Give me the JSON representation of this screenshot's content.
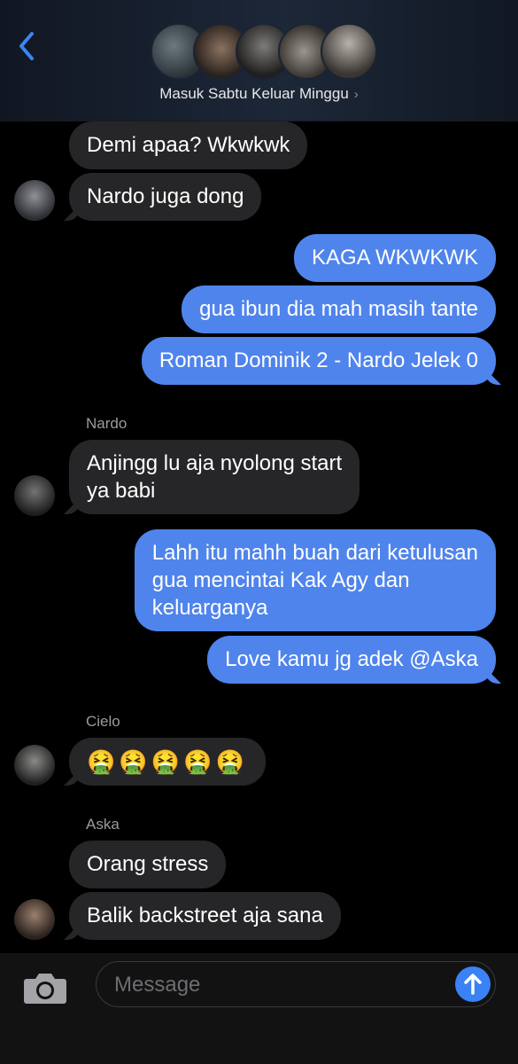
{
  "header": {
    "group_name": "Masuk Sabtu Keluar Minggu",
    "chevron": "›",
    "participants_count": 5
  },
  "messages": [
    {
      "side": "in",
      "text": "Demi apaa? Wkwkwk"
    },
    {
      "side": "in",
      "text": "Nardo juga dong"
    },
    {
      "side": "out",
      "text": "KAGA WKWKWK"
    },
    {
      "side": "out",
      "text": "gua ibun dia mah masih tante"
    },
    {
      "side": "out",
      "text": "Roman Dominik 2 - Nardo Jelek 0"
    },
    {
      "side": "in",
      "sender": "Nardo",
      "lines": [
        "Anjingg lu aja nyolong start",
        "ya babi"
      ]
    },
    {
      "side": "out",
      "lines": [
        "Lahh itu mahh buah dari ketulusan",
        "gua mencintai Kak Agy dan",
        "keluarganya"
      ]
    },
    {
      "side": "out",
      "text": "Love kamu jg adek @Aska"
    },
    {
      "side": "in",
      "sender": "Cielo",
      "text": "🤮🤮🤮🤮🤮"
    },
    {
      "side": "in",
      "sender": "Aska",
      "text": "Orang stress"
    },
    {
      "side": "in",
      "text": "Balik backstreet aja sana"
    }
  ],
  "composer": {
    "placeholder": "Message"
  },
  "icons": {
    "back": "chevron-left-icon",
    "camera": "camera-icon",
    "send": "arrow-up-icon"
  },
  "colors": {
    "outgoing_bubble": "#4f84ec",
    "incoming_bubble": "#262628",
    "accent": "#3a82f6"
  }
}
